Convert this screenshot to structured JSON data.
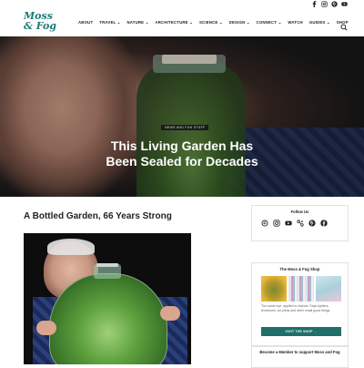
{
  "site": {
    "logo_line1": "Moss",
    "logo_line2": "& Fog",
    "brand_color": "#1f7a7a"
  },
  "social_top": [
    "facebook-icon",
    "instagram-icon",
    "pinterest-icon",
    "youtube-icon"
  ],
  "nav": {
    "items": [
      {
        "label": "ABOUT"
      },
      {
        "label": "TRAVEL ⌄"
      },
      {
        "label": "NATURE ⌄"
      },
      {
        "label": "ARCHITECTURE ⌄"
      },
      {
        "label": "SCIENCE ⌄"
      },
      {
        "label": "DESIGN ⌄"
      },
      {
        "label": "CONNECT ⌄"
      },
      {
        "label": "WATCH"
      },
      {
        "label": "GUIDES ⌄"
      },
      {
        "label": "SHOP"
      }
    ]
  },
  "hero": {
    "tag": "NEWS AND FUN STUFF",
    "title_line1": "This Living Garden Has",
    "title_line2": "Been Sealed for Decades"
  },
  "article": {
    "title": "A Bottled Garden, 66 Years Strong"
  },
  "sidebar": {
    "follow_title": "Follow Us",
    "follow_icons": [
      "threads-icon",
      "instagram-icon",
      "youtube-icon",
      "link-icon",
      "pinterest-icon",
      "facebook-icon"
    ],
    "shop_title": "The Moss & Fog Shop",
    "shop_text": "The same eye, applied to objects. Days lighters, terrariums, art prints and other small good things.",
    "shop_button": "VISIT THE SHOP →",
    "member_title": "Become a Member to support Moss and Fog",
    "button_color": "#1f6f6a"
  }
}
